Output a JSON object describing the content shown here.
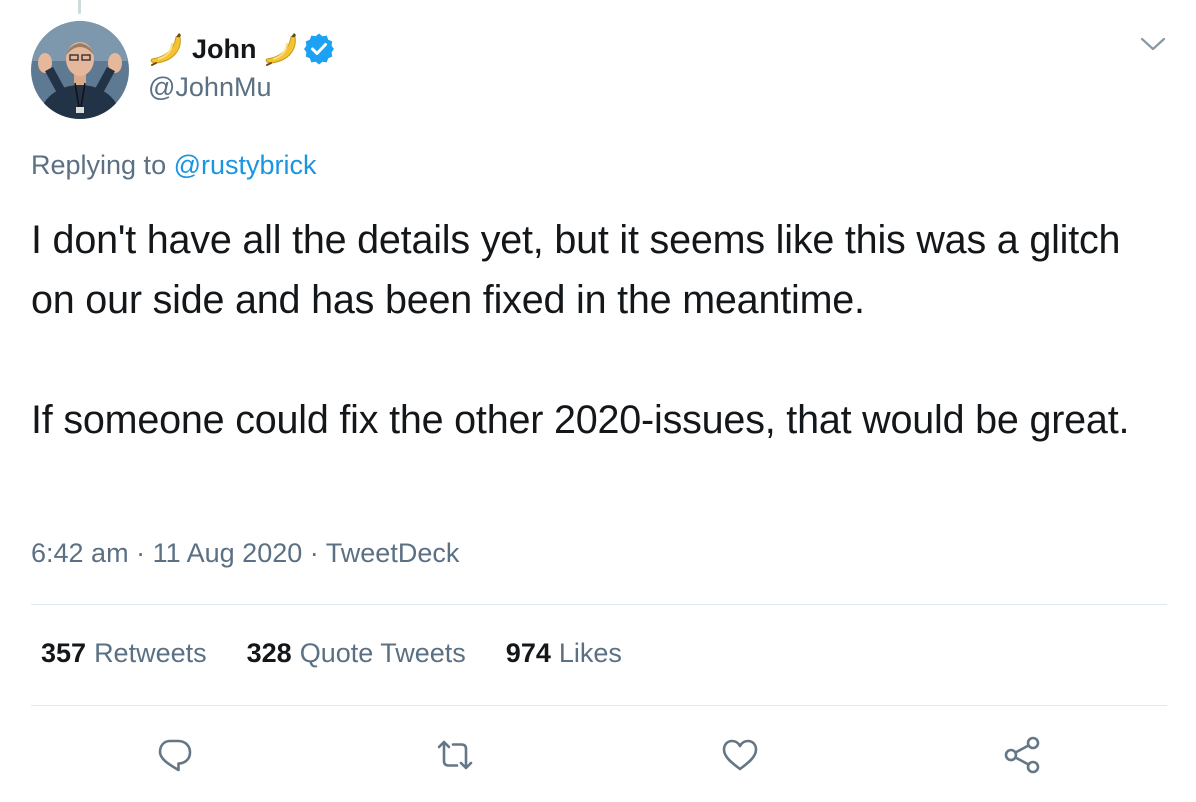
{
  "author": {
    "display_name": "John",
    "handle": "@JohnMu",
    "name_emoji_icon": "banana-icon",
    "badge_icon": "verified-badge-icon",
    "badge_color": "#1da1f2"
  },
  "reply": {
    "prefix": "Replying to",
    "mention": "@rustybrick"
  },
  "tweet": {
    "paragraph_1": "I don't have all the details yet, but it seems like this was a glitch on our side and has been fixed in the meantime.",
    "paragraph_2": "If someone could fix the other 2020-issues, that would be great."
  },
  "meta": {
    "time": "6:42 am",
    "separator": "·",
    "date": "11 Aug 2020",
    "source": "TweetDeck"
  },
  "stats": {
    "retweets_count": "357",
    "retweets_label": "Retweets",
    "quotes_count": "328",
    "quotes_label": "Quote Tweets",
    "likes_count": "974",
    "likes_label": "Likes"
  },
  "actions": [
    "reply-icon",
    "retweet-icon",
    "like-icon",
    "share-icon"
  ],
  "colors": {
    "text_primary": "#14171a",
    "text_secondary": "#5b7083",
    "link": "#1b95e0",
    "divider": "#e1e8ed"
  }
}
